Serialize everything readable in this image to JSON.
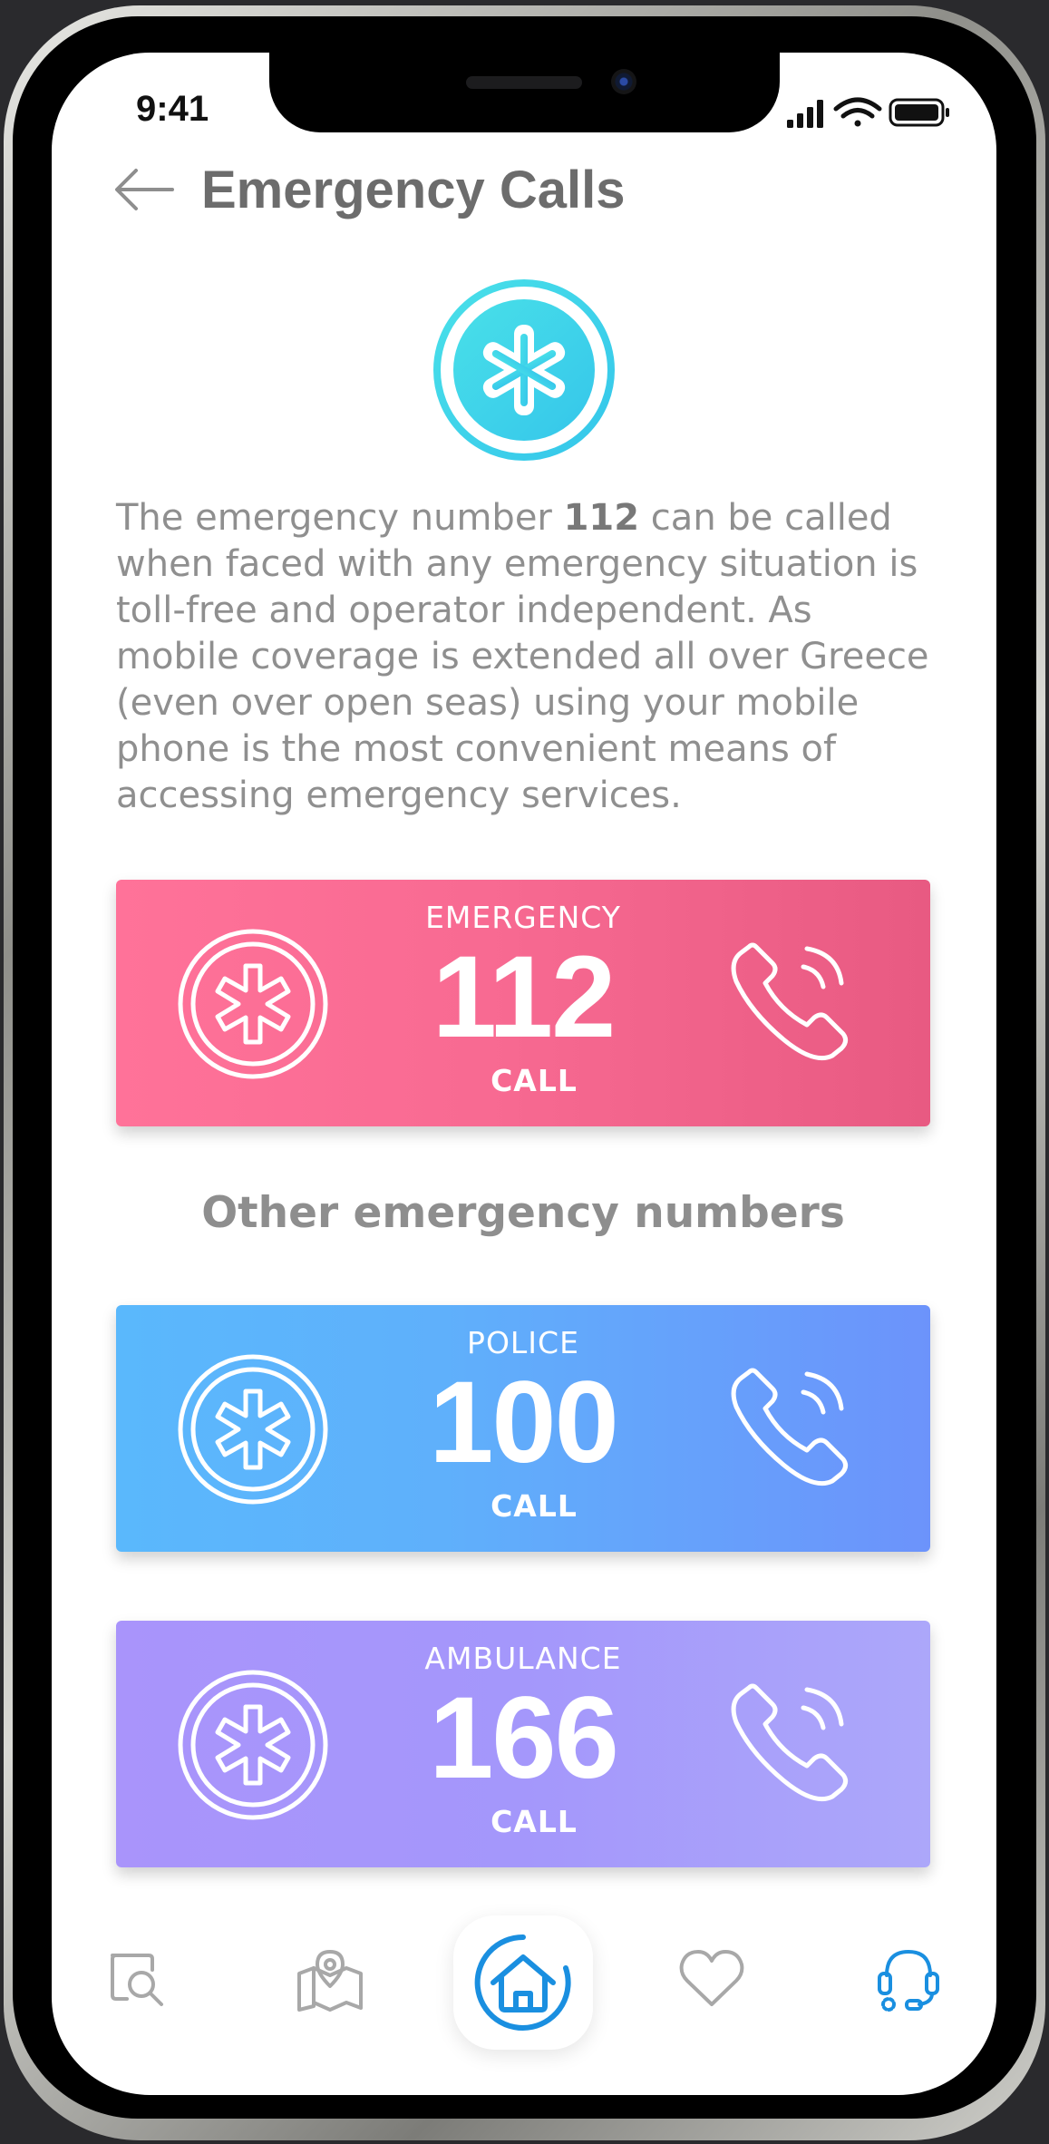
{
  "status_bar": {
    "time": "9:41"
  },
  "header": {
    "title": "Emergency Calls"
  },
  "description": {
    "before": "The emergency number ",
    "highlight": "112",
    "after": " can be called when faced with any emergency situation is toll-free and operator independent. As mobile coverage is extended all over Greece (even over open seas) using your mobile phone is the most convenient means of accessing emergency services."
  },
  "primary_card": {
    "name": "EMERGENCY",
    "number": "112",
    "action": "CALL"
  },
  "section_title": "Other emergency numbers",
  "other_cards": [
    {
      "name": "POLICE",
      "number": "100",
      "action": "CALL"
    },
    {
      "name": "AMBULANCE",
      "number": "166",
      "action": "CALL"
    }
  ],
  "tab_bar": {
    "items": [
      {
        "icon": "search-icon"
      },
      {
        "icon": "map-pin-icon"
      },
      {
        "icon": "home-icon",
        "selected": true
      },
      {
        "icon": "heart-icon"
      },
      {
        "icon": "headset-icon"
      }
    ]
  },
  "colors": {
    "emergency": "#f86a92",
    "police": "#5fb0fb",
    "ambulance": "#a994fb",
    "accent_blue": "#1a8fe0",
    "hero_teal": "#3fd6e8"
  }
}
